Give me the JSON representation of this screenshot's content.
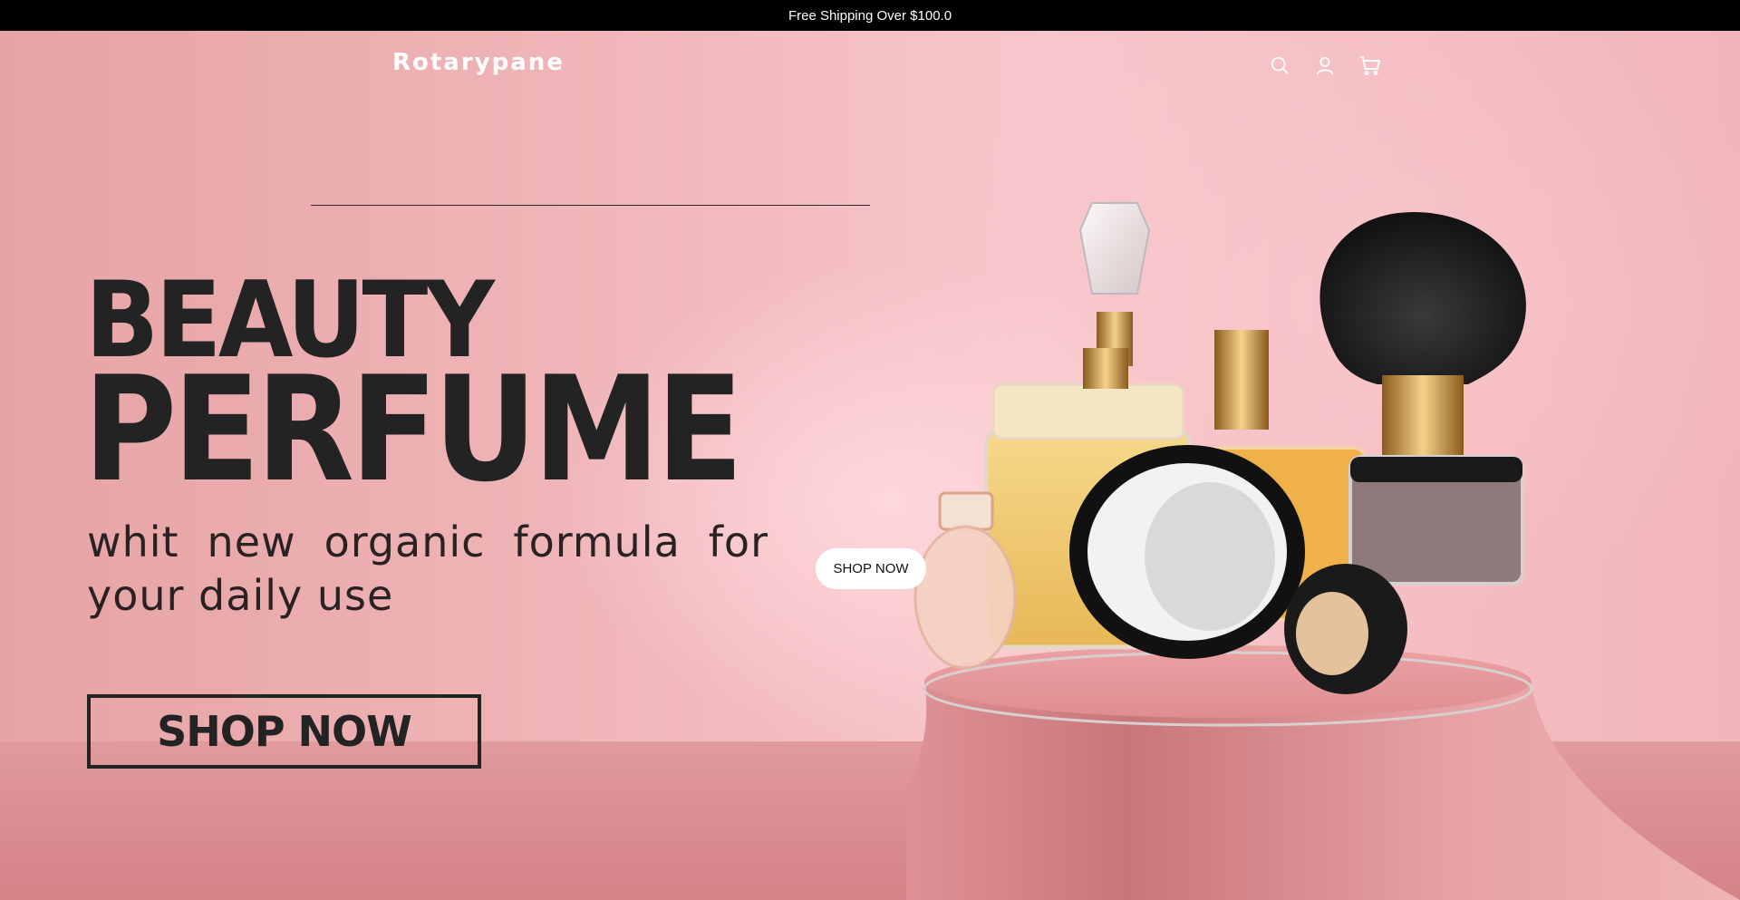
{
  "announcement": {
    "text": "Free Shipping Over $100.0"
  },
  "header": {
    "logo": "Rotarypane",
    "icons": [
      "search-icon",
      "account-icon",
      "cart-icon"
    ]
  },
  "hero": {
    "headline_line1": "BEAUTY",
    "headline_line2": "PERFUME",
    "subtitle": "whit new organic formula for your daily use",
    "cta_primary": "SHOP NOW",
    "cta_secondary": "SHOP NOW"
  },
  "colors": {
    "announcement_bg": "#000000",
    "hero_pink": "#f2b9bc",
    "text_dark": "#232323",
    "pedestal": "#e8989b"
  }
}
